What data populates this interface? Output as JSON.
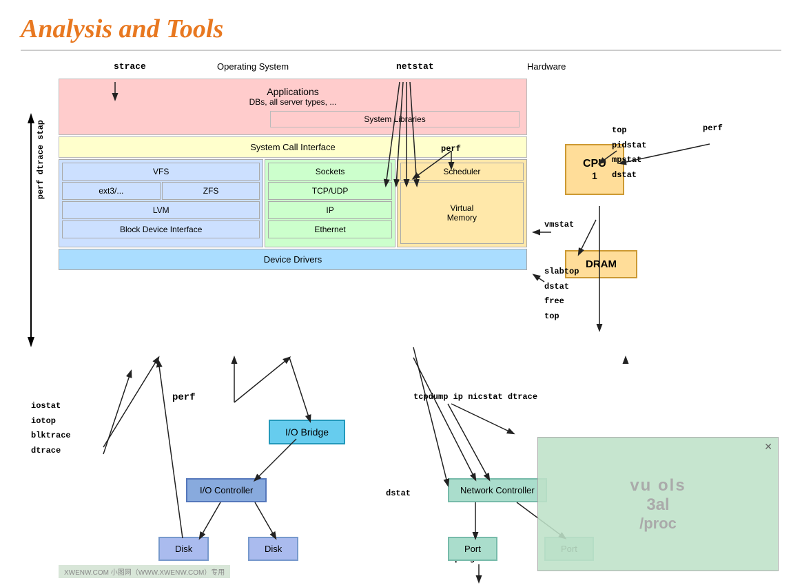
{
  "title": "Analysis and Tools",
  "diagram": {
    "top_labels": {
      "strace": "strace",
      "os": "Operating System",
      "netstat": "netstat",
      "hardware": "Hardware"
    },
    "left_labels": {
      "perf_dtrace_stap": "perf dtrace stap",
      "perf_dtrace": "perf dtrace"
    },
    "layers": {
      "applications": "Applications\nDBs, all server types, ...",
      "system_libraries": "System Libraries",
      "system_call_interface": "System Call Interface",
      "vfs": "VFS",
      "ext3": "ext3/...",
      "zfs": "ZFS",
      "lvm": "LVM",
      "block_device_interface": "Block Device Interface",
      "sockets": "Sockets",
      "tcp_udp": "TCP/UDP",
      "ip": "IP",
      "ethernet": "Ethernet",
      "scheduler": "Scheduler",
      "virtual_memory": "Virtual\nMemory",
      "device_drivers": "Device Drivers"
    },
    "hardware": {
      "cpu": "CPU\n1",
      "dram": "DRAM"
    },
    "bottom": {
      "io_bridge": "I/O Bridge",
      "io_controller": "I/O Controller",
      "disk1": "Disk",
      "disk2": "Disk",
      "network_controller": "Network Controller",
      "port1": "Port",
      "port2": "Port"
    },
    "tools": {
      "perf_top": "perf",
      "top": "top",
      "pidstat": "pidstat",
      "mpstat": "mpstat",
      "dstat_hw": "dstat",
      "perf_hw": "perf",
      "vmstat": "vmstat",
      "slabtop": "slabtop",
      "dstat_mid": "dstat",
      "free": "free",
      "top_mid": "top",
      "iostat": "iostat",
      "iotop": "iotop",
      "blktrace": "blktrace",
      "dtrace": "dtrace",
      "perf_bottom": "perf",
      "tcpdump": "tcpdump ip nicstat dtrace",
      "dstat_bottom": "dstat",
      "ping": "ping"
    },
    "blocked_overlay": {
      "line1": "vu ols",
      "line2": "3al",
      "line3": "/proc"
    }
  },
  "watermark": "XWENW.COM    小图网（WWW.XWENW.COM）专用"
}
